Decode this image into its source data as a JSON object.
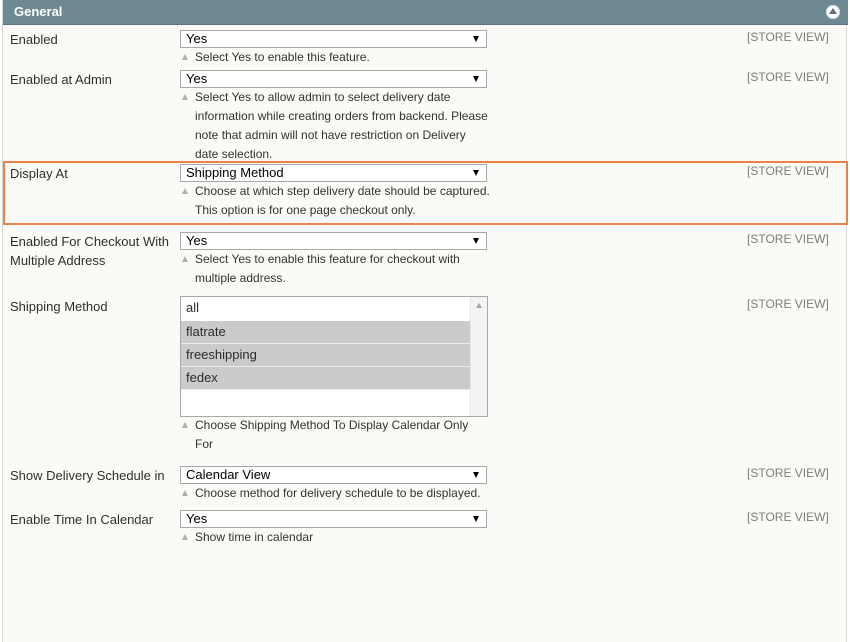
{
  "section": {
    "title": "General"
  },
  "rows": [
    {
      "label": "Enabled",
      "value": "Yes",
      "hint": "Select Yes to enable this feature.",
      "scope": "[STORE VIEW]"
    },
    {
      "label": "Enabled at Admin",
      "value": "Yes",
      "hint": "Select Yes to allow admin to select delivery date information while creating orders from backend. Please note that admin will not have restriction on Delivery date selection.",
      "scope": "[STORE VIEW]"
    },
    {
      "label": "Display At",
      "value": "Shipping Method",
      "hint": "Choose at which step delivery date should be captured. This option is for one page checkout only.",
      "scope": "[STORE VIEW]"
    },
    {
      "label": "Enabled For Checkout With Multiple Address",
      "value": "Yes",
      "hint": "Select Yes to enable this feature for checkout with multiple address.",
      "scope": "[STORE VIEW]"
    },
    {
      "label": "Shipping Method",
      "options": [
        "all",
        "flatrate",
        "freeshipping",
        "fedex"
      ],
      "hint": "Choose Shipping Method To Display Calendar Only For",
      "scope": "[STORE VIEW]"
    },
    {
      "label": "Show Delivery Schedule in",
      "value": "Calendar View",
      "hint": "Choose method for delivery schedule to be displayed.",
      "scope": "[STORE VIEW]"
    },
    {
      "label": "Enable Time In Calendar",
      "value": "Yes",
      "hint": "Show time in calendar",
      "scope": "[STORE VIEW]"
    }
  ],
  "colors": {
    "header": "#6f8992",
    "highlight": "#e8844a",
    "selected_option": "#cbcbcb"
  },
  "icons": [
    "collapse-icon",
    "hint-arrow-icon",
    "dropdown-arrow-icon",
    "scroll-up-arrow-icon"
  ]
}
